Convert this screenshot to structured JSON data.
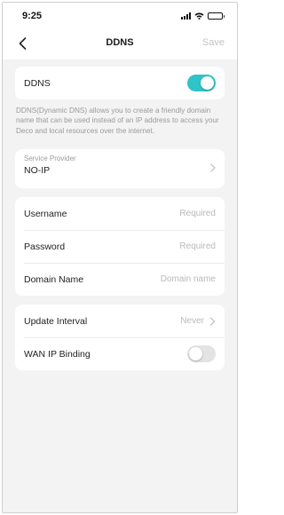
{
  "status_bar": {
    "time": "9:25",
    "icons": [
      "signal-icon",
      "wifi-icon",
      "battery-icon"
    ],
    "battery_level": 0.9
  },
  "nav": {
    "title": "DDNS",
    "save_label": "Save"
  },
  "ddns": {
    "label": "DDNS",
    "enabled": true,
    "description": "DDNS(Dynamic DNS) allows you to create a friendly domain name that can be used instead of an IP address to access your Deco and local resources over the internet."
  },
  "service_provider": {
    "caption": "Service Provider",
    "value": "NO-IP"
  },
  "credentials": {
    "username_label": "Username",
    "username_placeholder": "Required",
    "password_label": "Password",
    "password_placeholder": "Required",
    "domain_label": "Domain Name",
    "domain_placeholder": "Domain name"
  },
  "settings": {
    "update_interval_label": "Update Interval",
    "update_interval_value": "Never",
    "wan_binding_label": "WAN IP Binding",
    "wan_binding_enabled": false
  },
  "colors": {
    "accent": "#2ec4c9",
    "background": "#f3f3f4",
    "card": "#ffffff",
    "placeholder": "#b9b9b9"
  }
}
